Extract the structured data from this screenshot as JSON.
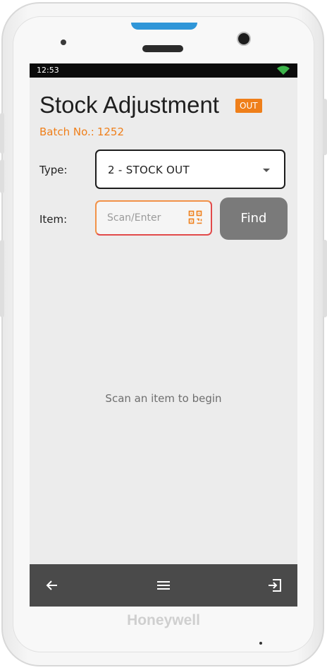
{
  "device": {
    "brand": "Honeywell"
  },
  "status_bar": {
    "time": "12:53"
  },
  "header": {
    "title": "Stock Adjustment",
    "badge": "OUT",
    "batch_label": "Batch No.:",
    "batch_number": "1252"
  },
  "form": {
    "type_label": "Type:",
    "type_value": "2 - STOCK OUT",
    "item_label": "Item:",
    "item_placeholder": "Scan/Enter",
    "find_label": "Find"
  },
  "content": {
    "empty_message": "Scan an item to begin"
  },
  "nav": {
    "icons": [
      "back-arrow-icon",
      "menu-icon",
      "exit-icon"
    ]
  },
  "colors": {
    "accent": "#ef7f1a",
    "nav_bar": "#4a4a4a",
    "find_button": "#7a7a7a",
    "screen_bg": "#ececec"
  }
}
